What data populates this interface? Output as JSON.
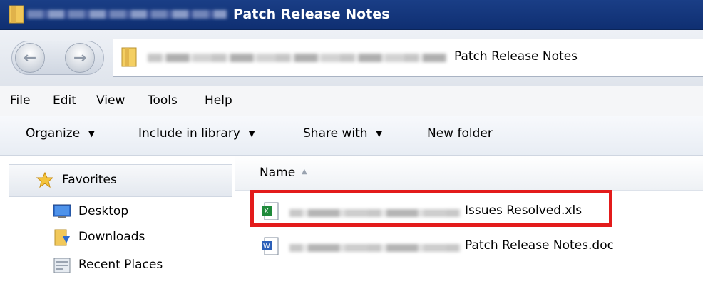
{
  "window": {
    "title": "Patch Release Notes"
  },
  "address": {
    "path_tail": "Patch Release Notes"
  },
  "menu": [
    "File",
    "Edit",
    "View",
    "Tools",
    "Help"
  ],
  "toolbar": {
    "organize": "Organize",
    "include_library": "Include in library",
    "share_with": "Share with",
    "new_folder": "New folder"
  },
  "navigation": {
    "favorites": "Favorites",
    "items": [
      "Desktop",
      "Downloads",
      "Recent Places"
    ]
  },
  "filelist": {
    "column_name": "Name",
    "files": [
      {
        "name_suffix": "Issues Resolved.xls",
        "icon": "excel-file-icon",
        "highlighted": true
      },
      {
        "name_suffix": "Patch Release Notes.doc",
        "icon": "word-file-icon",
        "highlighted": false
      }
    ]
  },
  "colors": {
    "titlebar": "#0f2f72",
    "highlight": "#e31b1b"
  }
}
